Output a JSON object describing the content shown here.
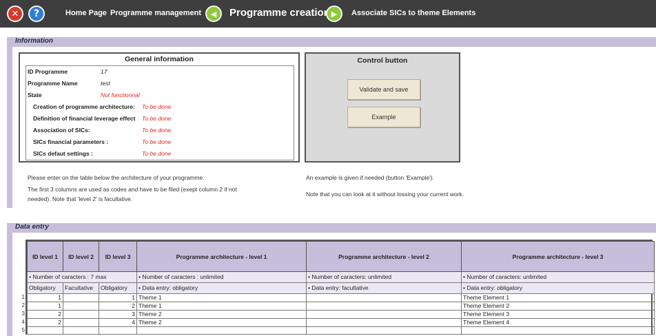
{
  "nav": {
    "home": "Home Page",
    "programme_management": "Programme management",
    "current": "Programme creation",
    "next": "Associate SICs to theme Elements"
  },
  "info_section": {
    "title": "Information"
  },
  "general_info": {
    "title": "General information",
    "rows": [
      {
        "label": "ID Programme",
        "value": "17"
      },
      {
        "label": "Programme Name",
        "value": "test"
      },
      {
        "label": "State",
        "value": "Not fonctionnal"
      },
      {
        "label": "Creation of programme architecture:",
        "value": "To be done"
      },
      {
        "label": "Definition of financial leverage effect",
        "value": "To be done"
      },
      {
        "label": "Association of SICs:",
        "value": "To be done"
      },
      {
        "label": "SICs financial parameters :",
        "value": "To be done"
      },
      {
        "label": "SICs defaut settings :",
        "value": "To be done"
      }
    ]
  },
  "control": {
    "title": "Control button",
    "validate_label": "Validate and save",
    "example_label": "Example"
  },
  "notes": {
    "left_1": "Please enter on the table below the architecture of your programme.",
    "left_2": "The first 3 columns are used as codes and have to be filed (exept column 2 if not",
    "left_3": "needed). Note that 'level 2' is facultative.",
    "right_1": "An example is given if needed (button 'Example').",
    "right_2": "Note that you can look at it without lossing your current work."
  },
  "data_section": {
    "title": "Data entry"
  },
  "table": {
    "headers": [
      "ID level 1",
      "ID level 2",
      "ID level 3",
      "Programme architecture - level 1",
      "Programme architecture - level 2",
      "Programme architecture - level 3"
    ],
    "sub1": [
      "• Number of caracters : 7 max",
      "• Number of caracters : unlimited",
      "• Number of caracters: unlimited",
      "• Number of caracters: unlimited"
    ],
    "sub2": [
      "Obligatory",
      "Facultative",
      "Obligatory",
      "• Data entry: obligatory",
      "• Data entry: facultative",
      "• Data entry: obligatory"
    ],
    "row_numbers": [
      "1",
      "2",
      "3",
      "4",
      "5"
    ],
    "rows": [
      [
        "1",
        "",
        "1",
        "Theme 1",
        "",
        "Theme Element 1"
      ],
      [
        "1",
        "",
        "2",
        "Theme 1",
        "",
        "Theme Element 2"
      ],
      [
        "2",
        "",
        "3",
        "Theme 2",
        "",
        "Theme Element 3"
      ],
      [
        "2",
        "",
        "4",
        "Theme 2",
        "",
        "Theme Element 4"
      ],
      [
        "",
        "",
        "",
        "",
        "",
        ""
      ]
    ]
  }
}
